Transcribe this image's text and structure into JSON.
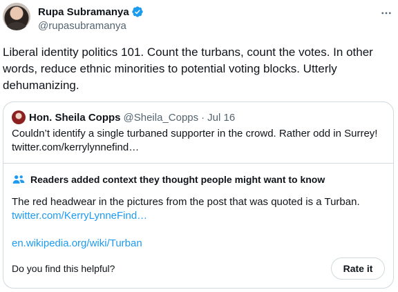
{
  "author": {
    "display_name": "Rupa Subramanya",
    "handle": "@rupasubramanya",
    "verified": true
  },
  "tweet": {
    "text": "Liberal identity politics 101. Count the turbans, count the votes. In other words, reduce ethnic minorities to potential voting blocks. Utterly dehumanizing."
  },
  "quote": {
    "display_name": "Hon. Sheila Copps",
    "handle": "@Sheila_Copps",
    "separator": "·",
    "date": "Jul 16",
    "text": "Couldn’t identify a single turbaned supporter in the crowd. Rather odd in Surrey! twitter.com/kerrylynnefind…"
  },
  "community_note": {
    "header": "Readers added context they thought people might want to know",
    "text": "The red headwear in the pictures from the post that was quoted is a Turban.",
    "link1": "twitter.com/KerryLynneFind…",
    "link2": "en.wikipedia.org/wiki/Turban",
    "helpful_question": "Do you find this helpful?",
    "rate_button": "Rate it"
  },
  "icons": {
    "verified": "verified-badge-icon",
    "more": "more-options-icon",
    "notes": "people-icon"
  },
  "colors": {
    "accent": "#1d9bf0",
    "text": "#0f1419",
    "secondary": "#536471",
    "border": "#cfd9de"
  }
}
